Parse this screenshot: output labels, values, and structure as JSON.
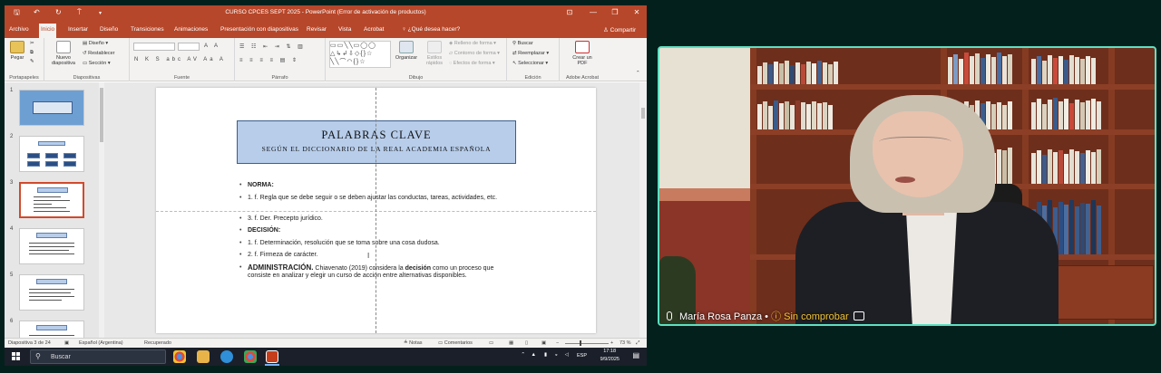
{
  "window": {
    "title": "CURSO CPCES SEPT 2025 - PowerPoint (Error de activación de productos)",
    "controls": [
      "⊡",
      "—",
      "❐",
      "✕"
    ]
  },
  "quick_access": [
    "🖫",
    "↶",
    "↻",
    "⍑",
    "▾"
  ],
  "tabs": [
    {
      "label": "Archivo"
    },
    {
      "label": "Inicio"
    },
    {
      "label": "Insertar"
    },
    {
      "label": "Diseño"
    },
    {
      "label": "Transiciones"
    },
    {
      "label": "Animaciones"
    },
    {
      "label": "Presentación con diapositivas"
    },
    {
      "label": "Revisar"
    },
    {
      "label": "Vista"
    },
    {
      "label": "Acrobat"
    }
  ],
  "tell_me": "♀ ¿Qué desea hacer?",
  "share": "♙ Compartir",
  "ribbon": {
    "paste": "Pegar",
    "new_slide": "Nuevo diapositiva",
    "design": "Diseño",
    "reset": "Restablecer",
    "section": "Sección",
    "arrange": "Organizar",
    "quick_styles": "Estilos rápidos",
    "shape_fill": "Relleno de forma",
    "shape_outline": "Contorno de forma",
    "shape_effects": "Efectos de forma",
    "find": "Buscar",
    "replace": "Reemplazar",
    "select": "Seleccionar",
    "create_pdf": "Crear un PDF",
    "groups": [
      "Portapapeles",
      "Diapositivas",
      "Fuente",
      "Párrafo",
      "Dibujo",
      "Edición",
      "Adobe Acrobat"
    ]
  },
  "thumbnails": {
    "numbers": [
      "1",
      "2",
      "3",
      "4",
      "5",
      "6"
    ],
    "selected": 3
  },
  "slide": {
    "title": "PALABRAS CLAVE",
    "subtitle": "SEGÚN EL DICCIONARIO DE LA REAL ACADEMIA ESPAÑOLA",
    "bullet_norma": "NORMA:",
    "bullet_norma_1": "1. f. Regla que se debe seguir o se deben ajustar las conductas, tareas, actividades, etc.",
    "bullet_norma_2": "3. f. Der. Precepto jurídico.",
    "bullet_decision": "DECISIÓN:",
    "bullet_decision_1": "1. f. Determinación, resolución que se toma sobre una cosa dudosa.",
    "bullet_decision_2": "2. f. Firmeza de carácter.",
    "admin_label": "ADMINISTRACIÓN.",
    "admin_text_a": "Chiavenato (2019) considera la",
    "admin_bold": "decisión",
    "admin_text_b": "como un proceso que consiste en analizar y elegir un curso de acción entre alternativas disponibles."
  },
  "status": {
    "slide_count": "Diapositiva 3 de 24",
    "language": "Español (Argentina)",
    "recovered": "Recuperado",
    "notes": "≜ Notas",
    "comments": "▭ Comentarios",
    "zoom": "73 %"
  },
  "taskbar": {
    "search": "Buscar",
    "lang": "ESP",
    "time": "17:18",
    "date": "9/9/2025"
  },
  "video": {
    "participant": "María Rosa Panza",
    "status": "Sin comprobar",
    "colors": {
      "border": "#5ee0c2",
      "warning": "#f4c430"
    }
  },
  "colors": {
    "powerpoint": "#b7472a",
    "title_box": "#b7cdea",
    "selected_thumb": "#d04a2c"
  }
}
